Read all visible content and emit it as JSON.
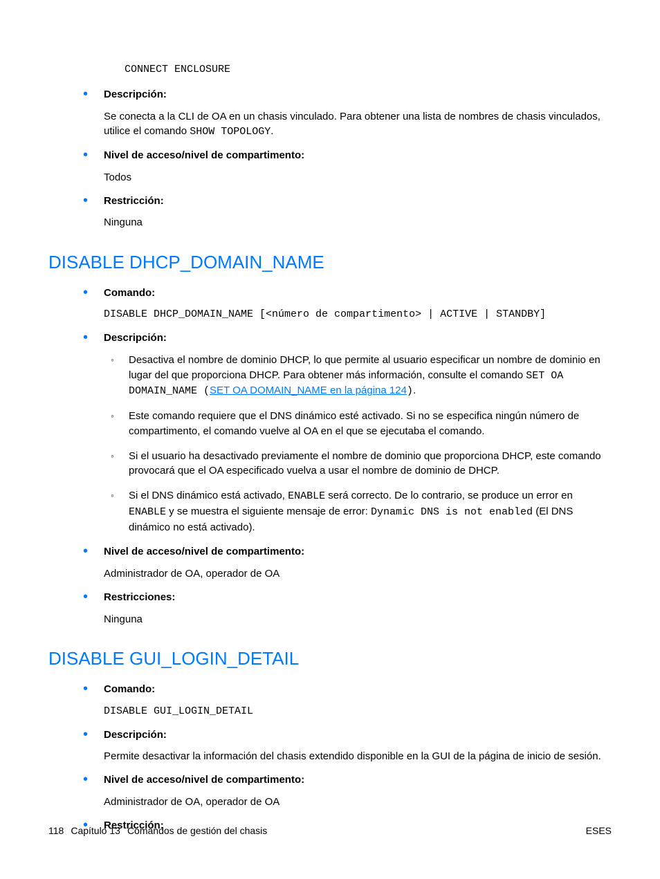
{
  "intro": {
    "code_top": "CONNECT ENCLOSURE",
    "items": [
      {
        "label": "Descripción:",
        "body_pre": "Se conecta a la CLI de OA en un chasis vinculado. Para obtener una lista de nombres de chasis vinculados, utilice el comando ",
        "body_code": "SHOW TOPOLOGY",
        "body_post": "."
      },
      {
        "label": "Nivel de acceso/nivel de compartimento:",
        "body": "Todos"
      },
      {
        "label": "Restricción:",
        "body": "Ninguna"
      }
    ]
  },
  "section1": {
    "heading": "DISABLE DHCP_DOMAIN_NAME",
    "comando_label": "Comando:",
    "comando_code": "DISABLE DHCP_DOMAIN_NAME [<número de compartimento> | ACTIVE | STANDBY]",
    "descripcion_label": "Descripción:",
    "sub": [
      {
        "pre": "Desactiva el nombre de dominio DHCP, lo que permite al usuario especificar un nombre de dominio en lugar del que proporciona DHCP. Para obtener más información, consulte el comando ",
        "code1": "SET OA DOMAIN_NAME",
        "paren_open": " (",
        "link": "SET OA DOMAIN_NAME en la página 124",
        "paren_close": ")",
        "post": "."
      },
      {
        "text": "Este comando requiere que el DNS dinámico esté activado. Si no se especifica ningún número de compartimento, el comando vuelve al OA en el que se ejecutaba el comando."
      },
      {
        "text": "Si el usuario ha desactivado previamente el nombre de dominio que proporciona DHCP, este comando provocará que el OA especificado vuelva a usar el nombre de dominio de DHCP."
      },
      {
        "pre": "Si el DNS dinámico está activado, ",
        "code1": "ENABLE",
        "mid1": " será correcto. De lo contrario, se produce un error en ",
        "code2": "ENABLE",
        "mid2": " y se muestra el siguiente mensaje de error: ",
        "code3": "Dynamic DNS is not enabled",
        "post": " (El DNS dinámico no está activado)."
      }
    ],
    "nivel_label": "Nivel de acceso/nivel de compartimento:",
    "nivel_body": "Administrador de OA, operador de OA",
    "restr_label": "Restricciones:",
    "restr_body": "Ninguna"
  },
  "section2": {
    "heading": "DISABLE GUI_LOGIN_DETAIL",
    "comando_label": "Comando:",
    "comando_code": "DISABLE GUI_LOGIN_DETAIL",
    "descripcion_label": "Descripción:",
    "descripcion_body": "Permite desactivar la información del chasis extendido disponible en la GUI de la página de inicio de sesión.",
    "nivel_label": "Nivel de acceso/nivel de compartimento:",
    "nivel_body": "Administrador de OA, operador de OA",
    "restr_label": "Restricción:"
  },
  "footer": {
    "page": "118",
    "chapter": "Capítulo 13",
    "title": "Comandos de gestión del chasis",
    "right": "ESES"
  }
}
